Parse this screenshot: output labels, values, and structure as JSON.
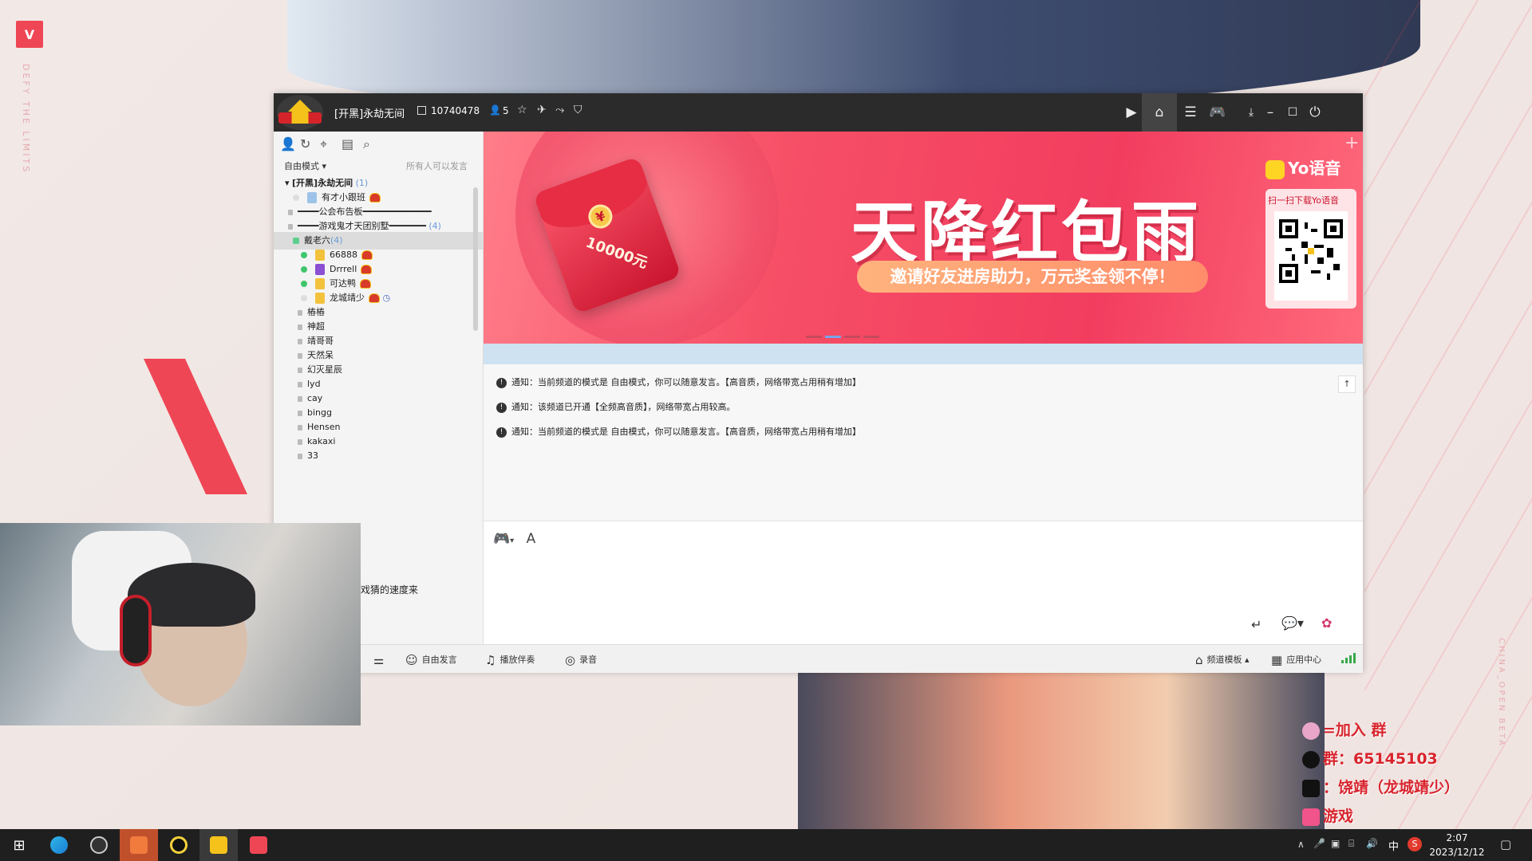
{
  "desktop": {
    "side_text": "DEFY THE LIMITS",
    "side_text_right": "CHINA_OPEN BETA",
    "accent": "#ef4655"
  },
  "window": {
    "channel_title": "[开黑]永劫无间",
    "channel_id": "10740478",
    "online_count": "5"
  },
  "sidebar": {
    "mode": "自由模式",
    "permission": "所有人可以发言",
    "tree": [
      {
        "label": "[开黑]永劫无间",
        "count": "(1)"
      },
      {
        "label": "有才小跟班"
      },
      {
        "label": "━━━━公会布告板━━━━━━━━━━━━━"
      },
      {
        "label": "━━━━游戏鬼才天团别墅━━━━━━━",
        "count": "(4)"
      },
      {
        "label": "戴老六",
        "count": "(4)"
      },
      {
        "label": "66888"
      },
      {
        "label": "Drrrell"
      },
      {
        "label": "可达鸭"
      },
      {
        "label": "龙城靖少"
      },
      {
        "label": "樁樁"
      },
      {
        "label": "神超"
      },
      {
        "label": "靖哥哥"
      },
      {
        "label": "天然呆"
      },
      {
        "label": "幻灭星辰"
      },
      {
        "label": "lyd"
      },
      {
        "label": "cay"
      },
      {
        "label": "bingg"
      },
      {
        "label": "Hensen"
      },
      {
        "label": "kakaxi"
      },
      {
        "label": "33"
      }
    ]
  },
  "banner": {
    "amount": "10000元",
    "headline": "天降红包雨",
    "subline": "邀请好友进房助力，万元奖金领不停！",
    "brand": "Yo语音",
    "qr_label": "扫一扫下载Yo语音"
  },
  "messages": [
    "通知：当前频道的模式是 自由模式，你可以随意发言。【高音质，网络带宽占用稍有增加】",
    "通知：该频道已开通【全频高音质】，网络带宽占用较高。",
    "通知：当前频道的模式是 自由模式，你可以随意发言。【高音质，网络带宽占用稍有增加】"
  ],
  "bottombar": {
    "free_speak": "自由发言",
    "play_music": "播放伴奏",
    "record": "录音",
    "channel_template": "频道模板",
    "app_center": "应用中心"
  },
  "webcam": {
    "caption": "戏猜的速度来"
  },
  "social": {
    "line1": "=加入  群",
    "line2": "群：65145103",
    "line3": "：饶靖（龙城靖少）",
    "line4": "游戏"
  },
  "taskbar": {
    "ime": "中",
    "time": "2:07",
    "date": "2023/12/12"
  }
}
